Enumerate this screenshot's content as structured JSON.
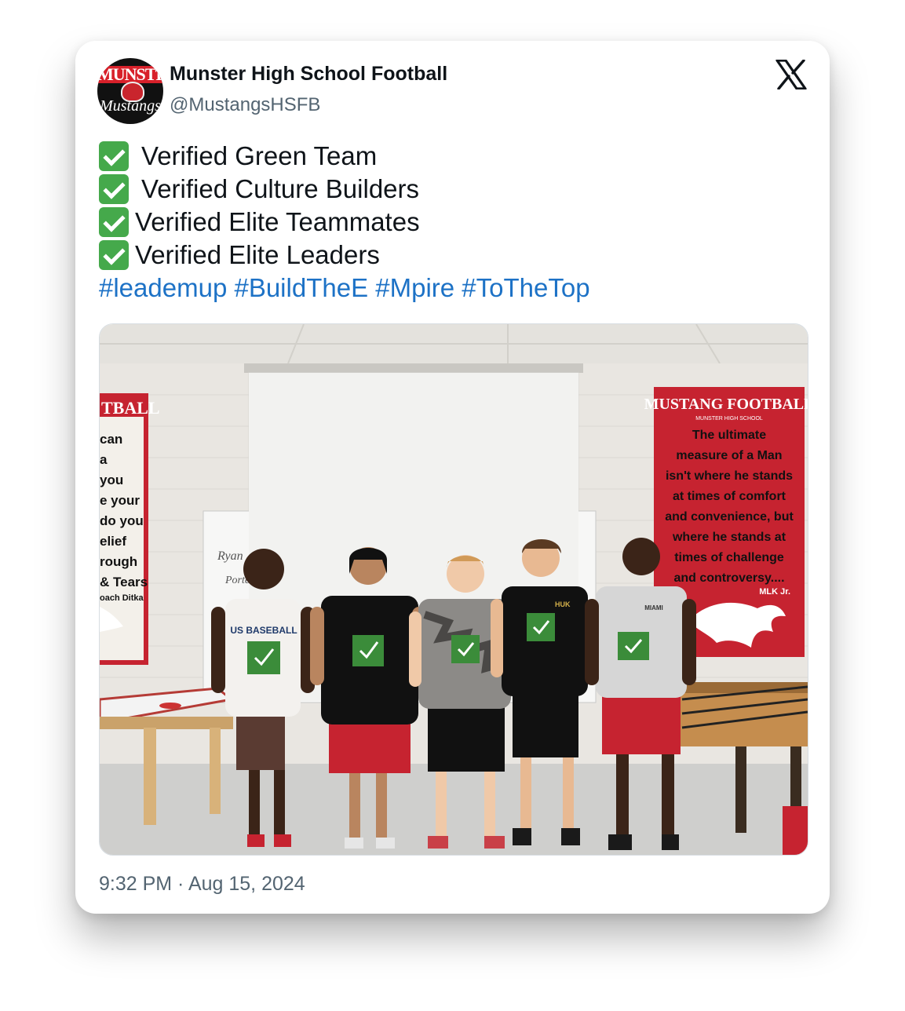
{
  "tweet": {
    "author_name": "Munster High School Football",
    "author_handle": "@MustangsHSFB",
    "avatar_text_top": "MUNSTER",
    "avatar_text_script": "Mustangs",
    "lines": [
      "Verified Green Team",
      "Verified Culture Builders",
      "Verified Elite Teammates",
      "Verified Elite Leaders"
    ],
    "hashtags": [
      "#leademup",
      "#BuildTheE",
      "#Mpire",
      "#ToTheTop"
    ],
    "timestamp": "9:32 PM · Aug 15, 2024",
    "check_icon": "white-heavy-check-mark",
    "brand_icon": "x-logo",
    "link_color": "#1d72c6"
  },
  "photo": {
    "poster_left_lines": [
      "TBALL",
      "can",
      "a",
      "you",
      "e your",
      "do you",
      "elief",
      "rough",
      "& Tears",
      "oach Ditka"
    ],
    "poster_right_title": "MUSTANG FOOTBALL",
    "poster_right_subtitle": "MUNSTER HIGH SCHOOL",
    "poster_right_lines": [
      "The ultimate",
      "measure of a Man",
      "isn't where he stands",
      "at times of comfort",
      "and convenience, but",
      "where he stands at",
      "times of challenge",
      "and controversy...."
    ],
    "poster_right_attribution": "MLK Jr.",
    "shirt_texts": [
      "US BASEBALL",
      "HUK",
      "MIAMI"
    ]
  }
}
